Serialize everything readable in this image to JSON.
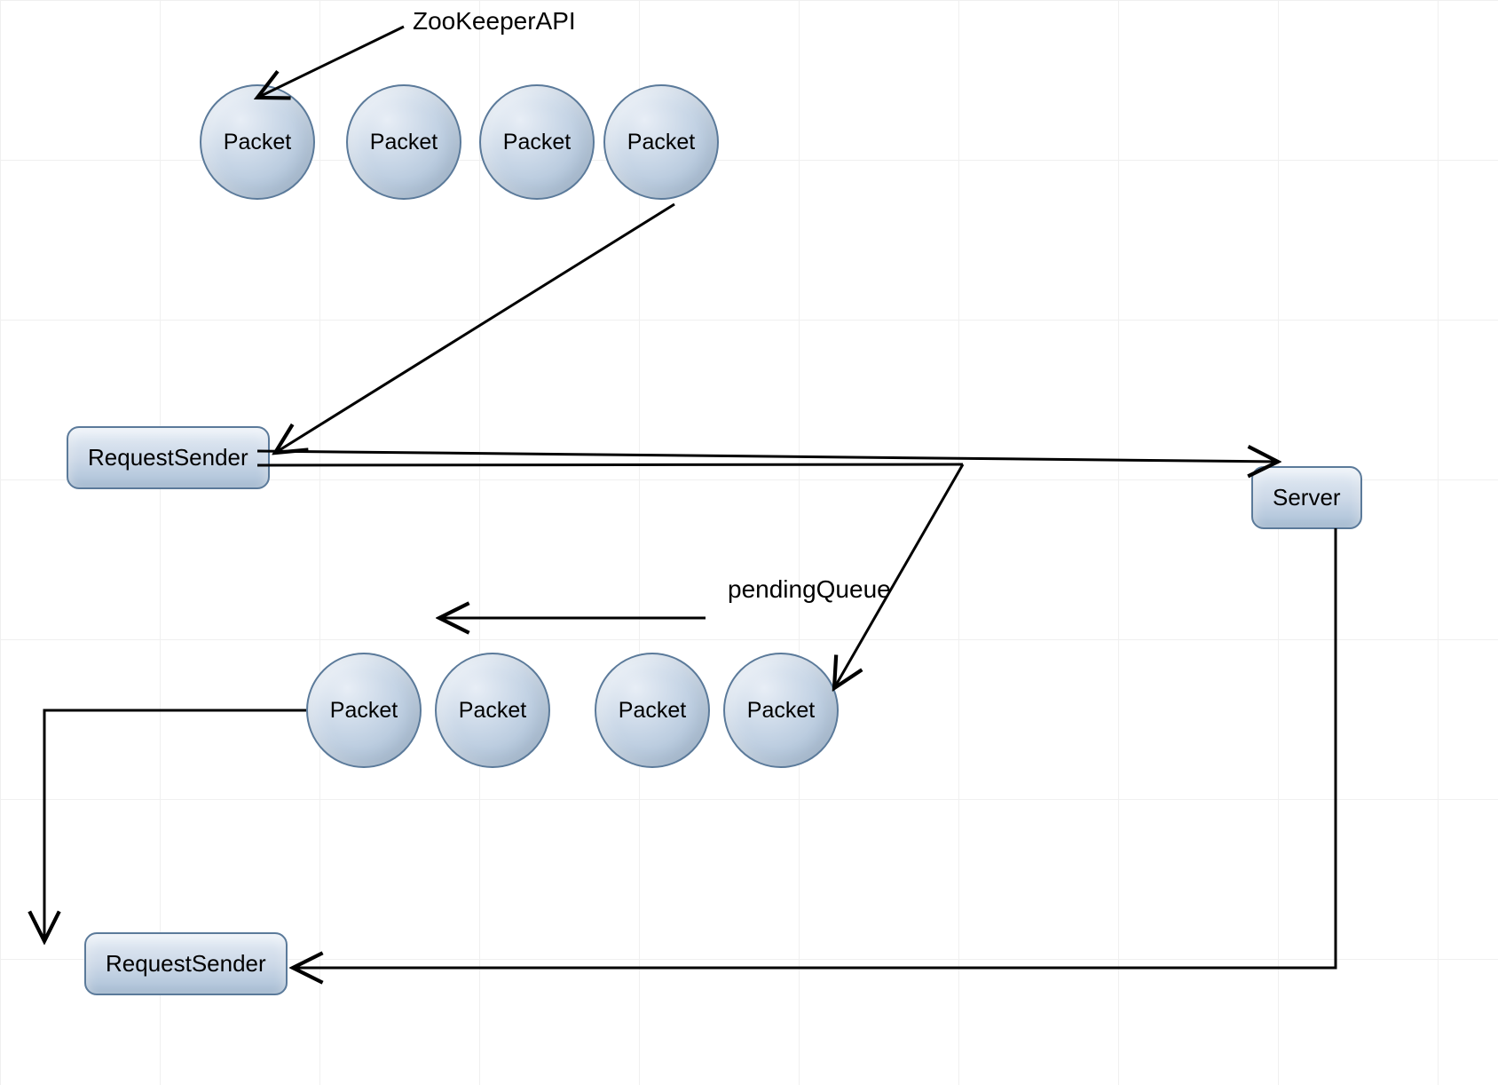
{
  "labels": {
    "zookeeper_api": "ZooKeeperAPI",
    "pending_queue": "pendingQueue"
  },
  "nodes": {
    "packet_row1": [
      "Packet",
      "Packet",
      "Packet",
      "Packet"
    ],
    "packet_row2": [
      "Packet",
      "Packet",
      "Packet",
      "Packet"
    ],
    "request_sender_1": "RequestSender",
    "request_sender_2": "RequestSender",
    "server": "Server"
  }
}
